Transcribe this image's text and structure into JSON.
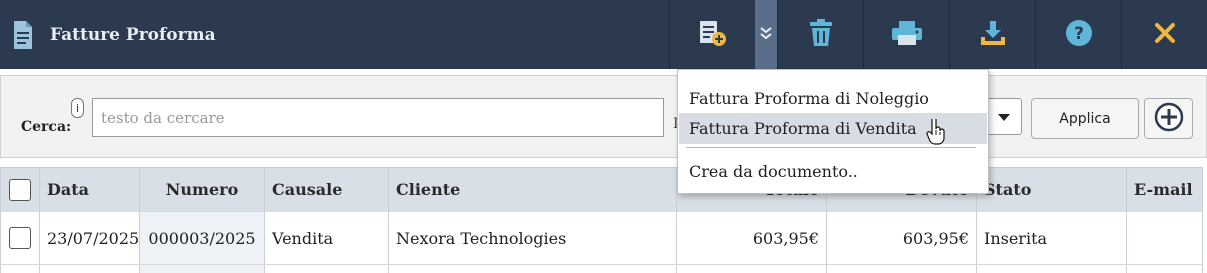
{
  "header": {
    "title": "Fatture Proforma",
    "icons": [
      "document-icon",
      "new-document-icon",
      "expand-chevrons-icon",
      "trash-icon",
      "print-icon",
      "download-icon",
      "help-icon",
      "close-icon"
    ],
    "accent": "#f0b840",
    "icon_color": "#5fb6d8"
  },
  "search": {
    "label": "Cerca:",
    "info": "i",
    "placeholder": "testo da cercare",
    "value": "",
    "cut_char": "I",
    "apply_label": "Applica"
  },
  "table": {
    "columns": [
      "Data",
      "Numero",
      "Causale",
      "Cliente",
      "Totale",
      "Dovuto",
      "Stato",
      "E-mail"
    ],
    "rows": [
      {
        "data": "23/07/2025",
        "numero": "000003/2025",
        "causale": "Vendita",
        "cliente": "Nexora Technologies",
        "totale": "603,95€",
        "dovuto": "603,95€",
        "stato": "Inserita",
        "email": ""
      }
    ]
  },
  "dropdown": {
    "items": [
      "Fattura Proforma di Noleggio",
      "Fattura Proforma di Vendita",
      "Crea da documento.."
    ],
    "highlighted_index": 1
  }
}
